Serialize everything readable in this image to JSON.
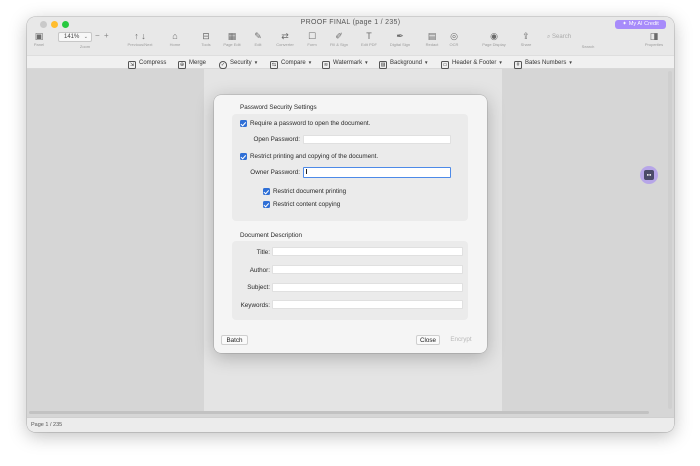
{
  "window": {
    "title": "PROOF FINAL (page 1 / 235)",
    "ai_button_label": "My AI Credit",
    "zoom": "141%"
  },
  "toolbar": {
    "left_labels": {
      "panel": "Panel",
      "zoom": "Zoom",
      "prev_next": "Previous/Next",
      "home": "Home"
    },
    "tools": [
      {
        "label": "Tools",
        "icon": "toolbox-icon"
      },
      {
        "label": "Page Edit",
        "icon": "grid-icon"
      },
      {
        "label": "Edit",
        "icon": "edit-icon"
      },
      {
        "label": "Converter",
        "icon": "convert-icon"
      },
      {
        "label": "Form",
        "icon": "form-icon"
      },
      {
        "label": "Fill & Sign",
        "icon": "sign-icon"
      },
      {
        "label": "Edit PDF",
        "icon": "text-icon"
      },
      {
        "label": "Digital Sign",
        "icon": "pen-icon"
      },
      {
        "label": "Redact",
        "icon": "redact-icon"
      },
      {
        "label": "OCR",
        "icon": "ocr-icon"
      },
      {
        "label": "Page Display",
        "icon": "eye-icon"
      },
      {
        "label": "Share",
        "icon": "share-icon"
      }
    ],
    "search_placeholder": "Search",
    "search_label": "Search",
    "right_label": "Properties"
  },
  "subtoolbar": [
    {
      "label": "Compress",
      "has_dropdown": false
    },
    {
      "label": "Merge",
      "has_dropdown": false
    },
    {
      "label": "Security",
      "has_dropdown": true
    },
    {
      "label": "Compare",
      "has_dropdown": true
    },
    {
      "label": "Watermark",
      "has_dropdown": true
    },
    {
      "label": "Background",
      "has_dropdown": true
    },
    {
      "label": "Header & Footer",
      "has_dropdown": true
    },
    {
      "label": "Bates Numbers",
      "has_dropdown": true
    }
  ],
  "dialog": {
    "password_section_title": "Password Security Settings",
    "require_open_password": {
      "label": "Require a password to open the document.",
      "checked": true
    },
    "open_password_label": "Open Password:",
    "open_password_value": "",
    "restrict_printing_copying": {
      "label": "Restrict printing and copying of the document.",
      "checked": true
    },
    "owner_password_label": "Owner Password:",
    "owner_password_value": "",
    "restrict_document_printing": {
      "label": "Restrict document printing",
      "checked": true
    },
    "restrict_content_copying": {
      "label": "Restrict content copying",
      "checked": true
    },
    "description_section_title": "Document Description",
    "fields": [
      {
        "label": "Title:",
        "value": ""
      },
      {
        "label": "Author:",
        "value": ""
      },
      {
        "label": "Subject:",
        "value": ""
      },
      {
        "label": "Keywords:",
        "value": ""
      }
    ],
    "batch_button": "Batch",
    "close_button": "Close",
    "encrypt_button": "Encrypt"
  },
  "status": {
    "page_indicator": "Page 1 / 235"
  },
  "colors": {
    "accent": "#2f6fd6",
    "ai_button": "#a78bfa",
    "focus_ring": "#4d8ae8"
  }
}
